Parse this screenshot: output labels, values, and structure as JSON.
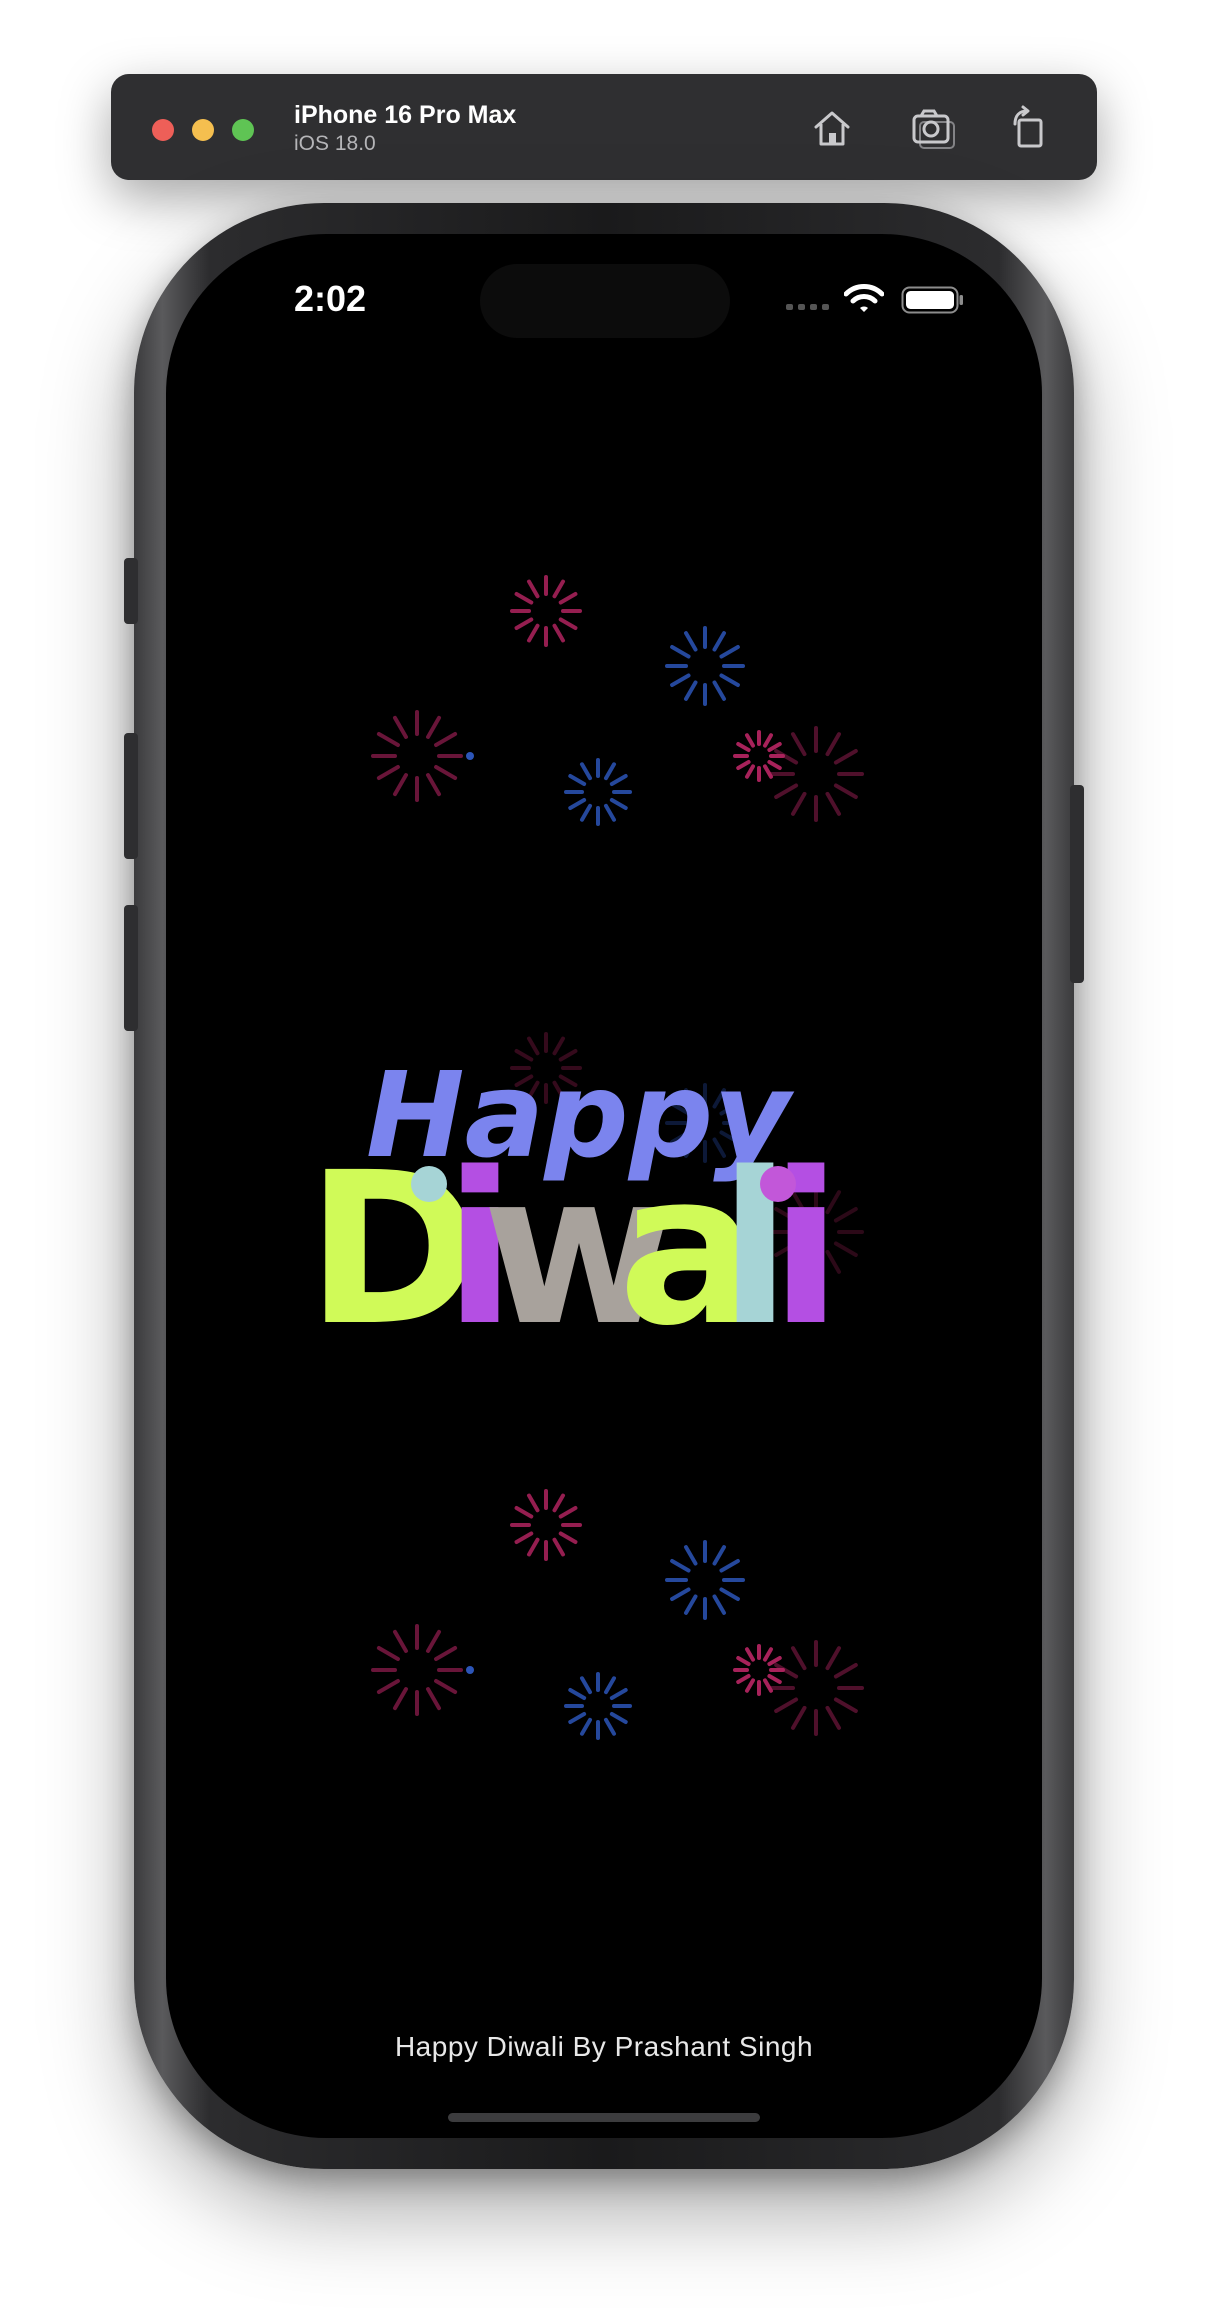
{
  "simulator": {
    "device_name": "iPhone 16 Pro Max",
    "os_version": "iOS 18.0",
    "icons": [
      "home-icon",
      "screenshot-icon",
      "rotate-icon"
    ]
  },
  "status_bar": {
    "time": "2:02",
    "icons": [
      "cellular-icon",
      "wifi-icon",
      "battery-icon"
    ]
  },
  "greeting": {
    "line1": "Happy",
    "line2_letters": [
      "D",
      "i",
      "w",
      "a",
      "l",
      "i"
    ],
    "colors": {
      "happy": "#7b84ee",
      "D": "#d0fa58",
      "i1": "#b44fe3",
      "w": "#a8a29c",
      "a": "#d0fa58",
      "l": "#a6d4d6",
      "i2": "#b44fe3",
      "dot_i1": "#a6d4d6",
      "dot_i2": "#c257d9"
    }
  },
  "fireworks": {
    "colors": {
      "magenta": "#b0245f",
      "blue": "#2c55b8"
    }
  },
  "footer": {
    "credit": "Happy Diwali By Prashant Singh"
  }
}
